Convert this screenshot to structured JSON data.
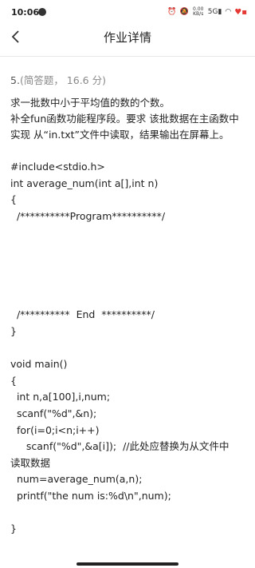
{
  "status_bar": {
    "time": "10:06",
    "net_speed": "0.00 KB/s",
    "signal": "5G",
    "icons": [
      "alarm-icon",
      "mute-icon",
      "data-speed",
      "signal-icon",
      "wifi-icon",
      "battery-icon"
    ]
  },
  "header": {
    "title": "作业详情",
    "back_icon": "chevron-left-icon"
  },
  "question": {
    "number": "5.",
    "meta": "(简答题， 16.6 分)",
    "description": "求一批数中小于平均值的数的个数。\n补全fun函数功能程序段。要求 该批数据在主函数中实现 从“in.txt”文件中读取，结果输出在屏幕上。",
    "code": "#include<stdio.h>\nint average_num(int a[],int n)\n{\n  /**********Program**********/\n\n\n\n\n\n  /**********  End  **********/\n}\n\nvoid main()\n{\n  int n,a[100],i,num;\n  scanf(\"%d\",&n);\n  for(i=0;i<n;i++)\n     scanf(\"%d\",&a[i]);  //此处应替换为从文件中\n读取数据\n  num=average_num(a,n);\n  printf(\"the num is:%d\\n\",num);\n\n}"
  }
}
